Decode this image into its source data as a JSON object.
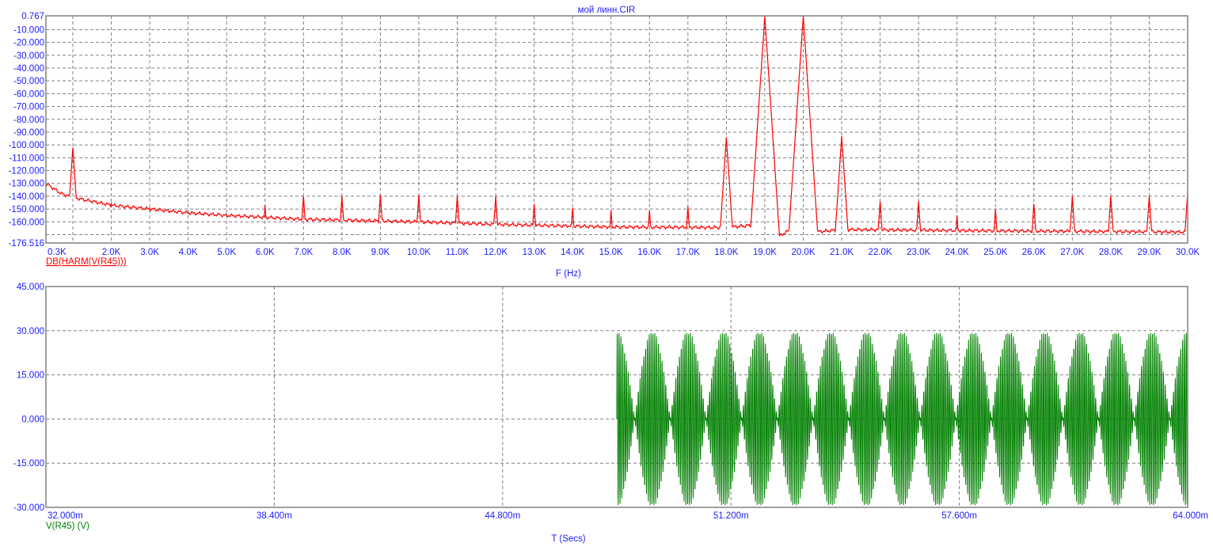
{
  "colors": {
    "axis_text": "#2020ff",
    "spectrum": "#ff0000",
    "waveform": "#008000",
    "grid": "#808080"
  },
  "chart_data": [
    {
      "type": "line",
      "title": "мой линн.CIR",
      "xlabel": "F (Hz)",
      "legend": "DB(HARM(V(R45)))",
      "legend_placement": "bottom-left",
      "grid": true,
      "xlim_khz": [
        0.3,
        30.0
      ],
      "ylim": [
        -176.516,
        0.767
      ],
      "x_tick_labels": [
        "0.3K",
        "2.0K",
        "3.0K",
        "4.0K",
        "5.0K",
        "6.0K",
        "7.0K",
        "8.0K",
        "9.0K",
        "10.0K",
        "11.0K",
        "12.0K",
        "13.0K",
        "14.0K",
        "15.0K",
        "16.0K",
        "17.0K",
        "18.0K",
        "19.0K",
        "20.0K",
        "21.0K",
        "22.0K",
        "23.0K",
        "24.0K",
        "25.0K",
        "26.0K",
        "27.0K",
        "28.0K",
        "29.0K",
        "30.0K"
      ],
      "y_tick_labels": [
        "0.767",
        "-10.000",
        "-20.000",
        "-30.000",
        "-40.000",
        "-50.000",
        "-60.000",
        "-70.000",
        "-80.000",
        "-90.000",
        "-100.000",
        "-110.000",
        "-120.000",
        "-130.000",
        "-140.000",
        "-150.000",
        "-160.000",
        "-176.516"
      ],
      "noise_floor": {
        "freq_khz": [
          0.3,
          0.7,
          1.0,
          2.0,
          3.0,
          4.0,
          5.0,
          7.0,
          10.0,
          12.0,
          15.0,
          18.0,
          18.9,
          19.1,
          19.9,
          20.1,
          20.3,
          21.0,
          25.0,
          30.0
        ],
        "db": [
          -130,
          -138,
          -141,
          -147,
          -150,
          -153,
          -155,
          -158,
          -160,
          -162,
          -164,
          -164.5,
          -162,
          -176,
          -162,
          -176,
          -168,
          -166,
          -167,
          -168
        ]
      },
      "peaks": {
        "freq_khz": [
          1,
          2,
          3,
          6,
          7,
          8,
          9,
          10,
          11,
          12,
          13,
          14,
          15,
          16,
          17,
          18,
          19,
          20,
          21,
          22,
          23,
          24,
          25,
          26,
          27,
          28,
          29,
          30
        ],
        "db": [
          -102,
          -145,
          -149,
          -147,
          -140,
          -140,
          -139,
          -139,
          -140,
          -140,
          -146,
          -149,
          -151,
          -151,
          -148,
          -94,
          0.5,
          0.5,
          -93,
          -144,
          -144,
          -155,
          -150,
          -146,
          -140,
          -140,
          -140,
          -137
        ]
      }
    },
    {
      "type": "line",
      "xlabel": "T (Secs)",
      "legend": "V(R45) (V)",
      "legend_placement": "bottom-left",
      "grid": true,
      "xlim_ms": [
        32,
        64
      ],
      "ylim": [
        -30,
        45
      ],
      "x_tick_labels": [
        "32.000m",
        "38.400m",
        "44.800m",
        "51.200m",
        "57.600m",
        "64.000m"
      ],
      "y_tick_labels": [
        "45.000",
        "30.000",
        "15.000",
        "0.000",
        "-15.000",
        "-30.000"
      ],
      "signal": {
        "start_ms": 48.0,
        "components": [
          {
            "freq_hz": 19000,
            "amplitude": 15
          },
          {
            "freq_hz": 20000,
            "amplitude": 15
          }
        ]
      }
    }
  ]
}
